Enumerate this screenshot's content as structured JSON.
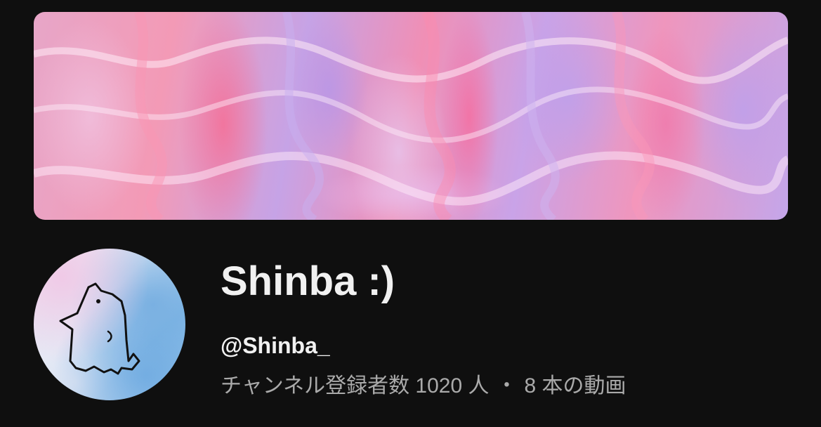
{
  "channel": {
    "name": "Shinba :)",
    "handle": "@Shinba_",
    "subscribers": "チャンネル登録者数 1020 人",
    "separator": "・",
    "videos": "8 本の動画"
  },
  "colors": {
    "background": "#0f0f0f",
    "primary_text": "#f1f1f1",
    "secondary_text": "#aaaaaa"
  }
}
